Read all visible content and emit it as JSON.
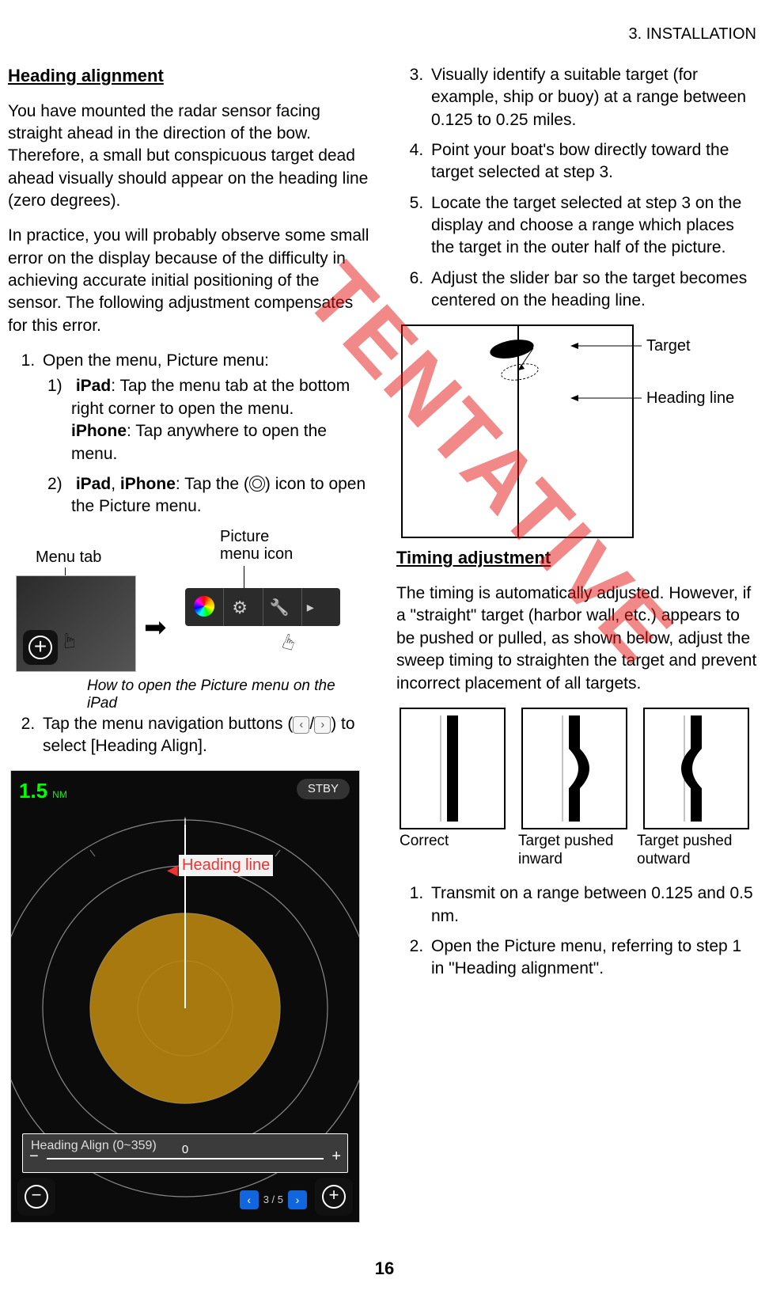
{
  "header": {
    "running": "3.  INSTALLATION"
  },
  "left": {
    "h1": "Heading alignment",
    "p1": "You have mounted the radar sensor facing straight ahead in the direction of the bow. Therefore, a small but conspicuous target dead ahead visually should appear on the heading line (zero degrees).",
    "p2": "In practice, you will probably observe some small error on the display because of the difficulty in achieving accurate initial positioning of the sensor. The following adjustment compensates for this error.",
    "step1": "Open the menu, Picture menu:",
    "step1a_lead": "iPad",
    "step1a": ": Tap the menu tab at the bottom right corner to open the menu.",
    "step1a_lead2": "iPhone",
    "step1a2": ": Tap anywhere to open the menu.",
    "step1b_lead": "iPad",
    "step1b_lead2": "iPhone",
    "step1b": ": Tap the (",
    "step1b_tail": ") icon to open the Picture menu.",
    "illus": {
      "menutab": "Menu tab",
      "picicon": "Picture\nmenu icon",
      "caption": "How to open the Picture menu on the iPad"
    },
    "step2a": "Tap the menu navigation buttons (",
    "step2b": ") to select [Heading Align].",
    "radar": {
      "range": "1.5",
      "unit": "NM",
      "stby": "STBY",
      "headline": "Heading line",
      "slider_label": "Heading Align (0~359)",
      "slider_value": "0",
      "pager": "3 / 5"
    }
  },
  "right": {
    "step3": "Visually identify a suitable target (for example, ship or buoy) at a range between 0.125 to 0.25 miles.",
    "step4": "Point your boat's bow directly toward the target selected at step 3.",
    "step5": "Locate the target selected at step 3 on the display and choose a range which places the target in the outer half of the picture.",
    "step6": "Adjust the slider bar so the target becomes centered on the heading line.",
    "diag": {
      "target": "Target",
      "heading": "Heading line"
    },
    "h2": "Timing adjustment",
    "t_p1": "The timing is automatically adjusted. However, if a \"straight\" target (harbor wall, etc.) appears to be pushed or pulled, as shown below, adjust the sweep timing to straighten the target and prevent incorrect placement of all targets.",
    "caps": {
      "c1": "Correct",
      "c2": "Target pushed inward",
      "c3": "Target pushed outward"
    },
    "t_s1": "Transmit on a range between 0.125 and 0.5 nm.",
    "t_s2": "Open the Picture menu, referring to step 1 in \"Heading alignment\"."
  },
  "watermark": "TENTATIVE",
  "page_number": "16"
}
